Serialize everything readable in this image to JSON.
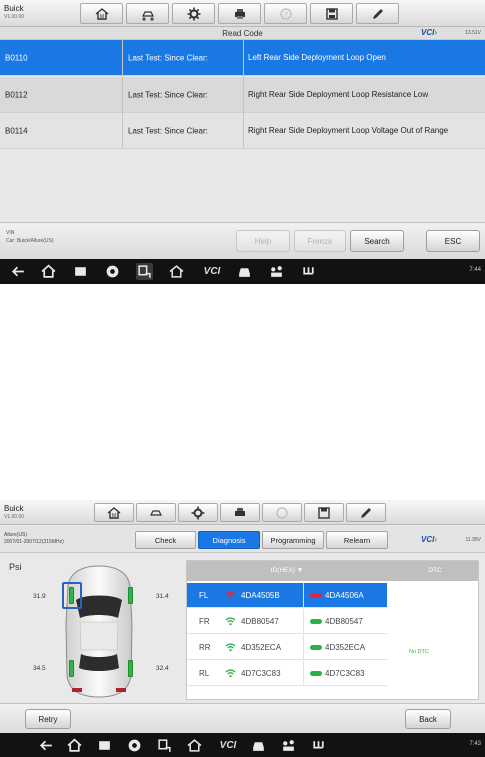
{
  "screen1": {
    "vehicle": {
      "make": "Buick",
      "version": "V1.00.00"
    },
    "subtitle": "Read Code",
    "vci_label": "VCI",
    "battery": "13.51V",
    "codes": [
      {
        "code": "B0110",
        "status": "Last Test: Since Clear:",
        "description": "Left Rear Side Deployment Loop Open",
        "selected": true
      },
      {
        "code": "B0112",
        "status": "Last Test: Since Clear:",
        "description": "Right Rear Side Deployment Loop Resistance Low",
        "selected": false
      },
      {
        "code": "B0114",
        "status": "Last Test: Since Clear:",
        "description": "Right Rear Side Deployment Loop Voltage Out of Range",
        "selected": false
      }
    ],
    "vin_label": "VIN",
    "car_label": "Car: Buick/Allure(US)",
    "buttons": {
      "help": "Help",
      "freeze": "Freeze",
      "search": "Search",
      "esc": "ESC"
    },
    "status_time": "7:44"
  },
  "screen2": {
    "vehicle": {
      "make": "Buick",
      "version": "V1.00.00"
    },
    "car_info_line1": "Allure(US)",
    "car_info_line2": "2007/01-2007/12(315MHz)",
    "tabs": {
      "check": "Check",
      "diagnosis": "Diagnosis",
      "programming": "Programming",
      "relearn": "Relearn"
    },
    "vci_label": "VCI",
    "battery": "11.95V",
    "unit": "Psi",
    "pressures": {
      "fl": "31.9",
      "fr": "31.4",
      "rl": "34.5",
      "rr": "32.4"
    },
    "table_header": {
      "id": "ID(HEX) ▼",
      "dtc": "DTC"
    },
    "sensors": [
      {
        "pos": "FL",
        "id_read": "4DA4505B",
        "id_saved": "4DA4506A"
      },
      {
        "pos": "FR",
        "id_read": "4DB80547",
        "id_saved": "4DB80547"
      },
      {
        "pos": "RR",
        "id_read": "4D352ECA",
        "id_saved": "4D352ECA"
      },
      {
        "pos": "RL",
        "id_read": "4D7C3C83",
        "id_saved": "4D7C3C83"
      }
    ],
    "dtc_status": "No DTC",
    "buttons": {
      "retry": "Retry",
      "back": "Back"
    },
    "status_time": "7:43"
  }
}
